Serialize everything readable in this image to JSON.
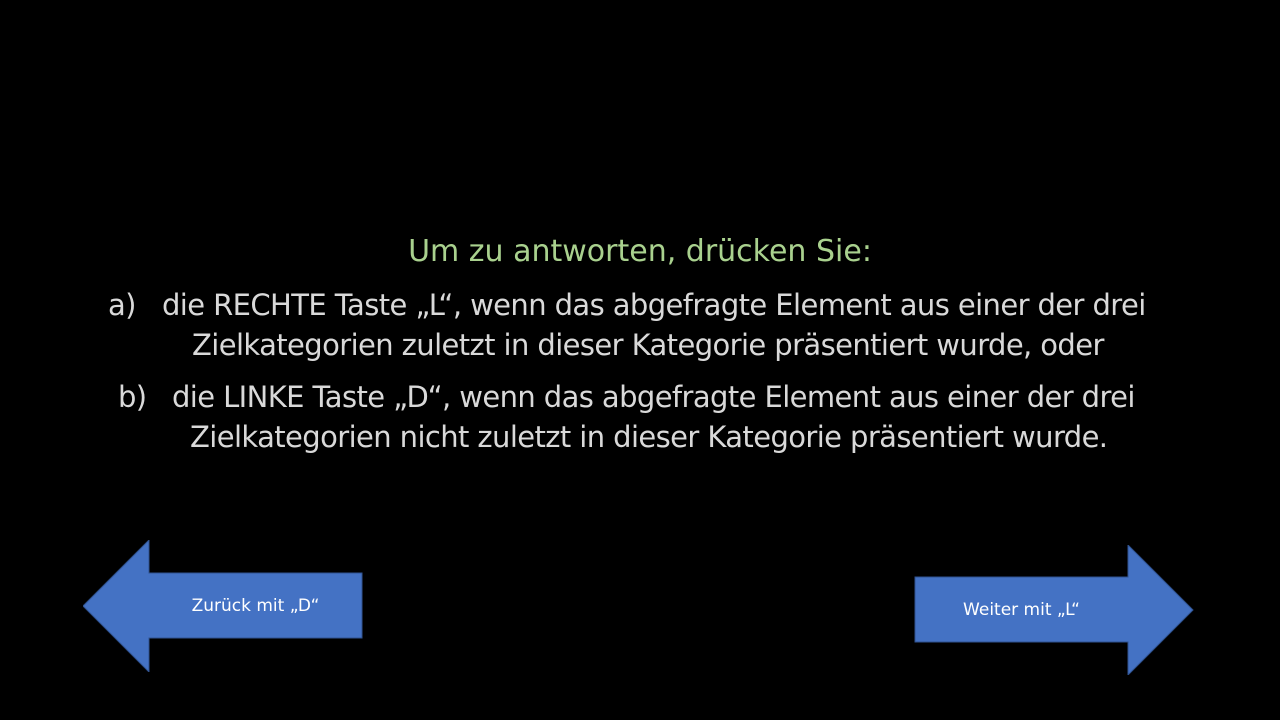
{
  "instructions": {
    "heading": "Um zu antworten, drücken Sie:",
    "items": [
      {
        "marker": "a)",
        "line1": "die RECHTE Taste „L“, wenn das abgefragte Element aus einer der drei",
        "line2": "Zielkategorien zuletzt in dieser Kategorie präsentiert wurde, oder"
      },
      {
        "marker": "b)",
        "line1": "die LINKE Taste „D“, wenn das abgefragte Element aus einer der drei",
        "line2": "Zielkategorien nicht zuletzt in dieser Kategorie präsentiert wurde."
      }
    ]
  },
  "navigation": {
    "back_label": "Zurück mit „D“",
    "next_label": "Weiter mit „L“"
  },
  "colors": {
    "background": "#000000",
    "heading": "#a9d18e",
    "body_text": "#d9d9d9",
    "arrow_fill": "#4472c4",
    "arrow_text": "#ffffff"
  }
}
